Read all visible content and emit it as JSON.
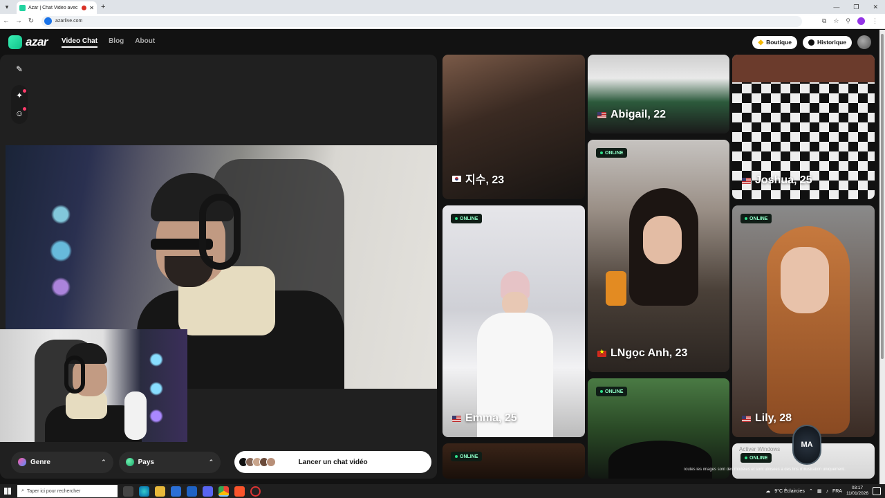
{
  "browser": {
    "tab_title": "Azar | Chat Vidéo avec de n",
    "tab_close": "✕",
    "new_tab": "+",
    "url": "azarlive.com",
    "window_controls": [
      "—",
      "❐",
      "✕"
    ]
  },
  "header": {
    "logo_text": "azar",
    "nav": [
      {
        "label": "Video Chat",
        "active": true
      },
      {
        "label": "Blog",
        "active": false
      },
      {
        "label": "About",
        "active": false
      }
    ],
    "boutique_label": "Boutique",
    "historique_label": "Historique"
  },
  "tools": [
    {
      "icon": "edit-icon",
      "glyph": "✎"
    },
    {
      "icon": "sparkle-effects-icon",
      "glyph": "✦"
    },
    {
      "icon": "sticker-face-icon",
      "glyph": "☺"
    }
  ],
  "filters": {
    "gender_label": "Genre",
    "country_label": "Pays",
    "chevron": "⌃"
  },
  "cta_label": "Lancer un chat vidéo",
  "badge_label": "ONLINE",
  "cards": [
    {
      "name": "지수, 23",
      "flag": "kr"
    },
    {
      "name": "Abigail, 22",
      "flag": "us"
    },
    {
      "name": "Joshua, 25",
      "flag": "us"
    },
    {
      "name": "Emma, 25",
      "flag": "us"
    },
    {
      "name": "LNgọc Anh, 23",
      "flag": "vn"
    },
    {
      "name": "Lily, 28",
      "flag": "us"
    }
  ],
  "overlay": {
    "activate_windows": "Activer Windows",
    "disclaimer": "Toutes les images sont des modèles et sont utilisées à des fins d'illustration uniquement.",
    "watermark_text": "MA"
  },
  "taskbar": {
    "search_placeholder": "Taper ici pour rechercher",
    "weather": "9°C  Éclaircies",
    "lang": "FRA",
    "time": "03:17",
    "date": "11/01/2026"
  },
  "colors": {
    "accent_green": "#2ee08a",
    "app_bg": "#121212",
    "panel_bg": "#202020"
  }
}
